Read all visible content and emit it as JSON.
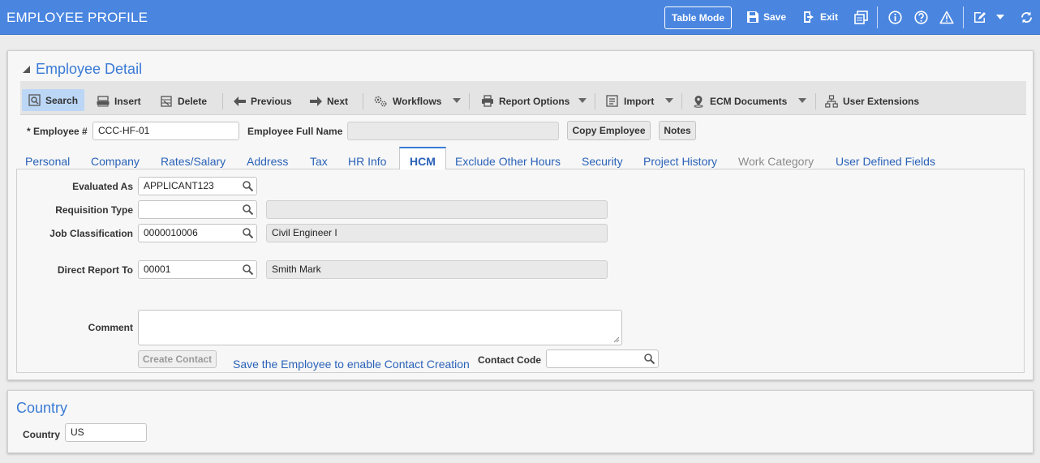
{
  "header": {
    "title": "EMPLOYEE PROFILE",
    "table_mode_label": "Table Mode",
    "save_label": "Save",
    "exit_label": "Exit"
  },
  "detail": {
    "title": "Employee Detail",
    "toolbar": {
      "search": "Search",
      "insert": "Insert",
      "delete": "Delete",
      "previous": "Previous",
      "next": "Next",
      "workflows": "Workflows",
      "report_options": "Report Options",
      "import": "Import",
      "ecm_documents": "ECM Documents",
      "user_extensions": "User Extensions"
    },
    "employee_number_label": "* Employee #",
    "employee_number_value": "CCC-HF-01",
    "employee_full_name_label": "Employee Full Name",
    "employee_full_name_value": "",
    "copy_employee_label": "Copy Employee",
    "notes_label": "Notes"
  },
  "tabs": [
    {
      "label": "Personal",
      "state": "normal"
    },
    {
      "label": "Company",
      "state": "normal"
    },
    {
      "label": "Rates/Salary",
      "state": "normal"
    },
    {
      "label": "Address",
      "state": "normal"
    },
    {
      "label": "Tax",
      "state": "normal"
    },
    {
      "label": "HR Info",
      "state": "normal"
    },
    {
      "label": "HCM",
      "state": "active"
    },
    {
      "label": "Exclude Other Hours",
      "state": "normal"
    },
    {
      "label": "Security",
      "state": "normal"
    },
    {
      "label": "Project History",
      "state": "normal"
    },
    {
      "label": "Work Category",
      "state": "disabled"
    },
    {
      "label": "User Defined Fields",
      "state": "normal"
    }
  ],
  "hcm": {
    "evaluated_as": {
      "label": "Evaluated As",
      "value": "APPLICANT123"
    },
    "requisition_type": {
      "label": "Requisition Type",
      "value": "",
      "description": ""
    },
    "job_classification": {
      "label": "Job Classification",
      "value": "0000010006",
      "description": "Civil Engineer I"
    },
    "direct_report_to": {
      "label": "Direct Report To",
      "value": "00001",
      "description": "Smith Mark"
    },
    "comment": {
      "label": "Comment",
      "value": ""
    },
    "create_contact_label": "Create Contact",
    "contact_notice": "Save the Employee to enable Contact Creation",
    "contact_code": {
      "label": "Contact Code",
      "value": ""
    }
  },
  "country_section": {
    "title": "Country",
    "label": "Country",
    "value": "US"
  },
  "colors": {
    "header_bg": "#4a86e0",
    "accent": "#3a7bd5",
    "link": "#2a62b8"
  }
}
